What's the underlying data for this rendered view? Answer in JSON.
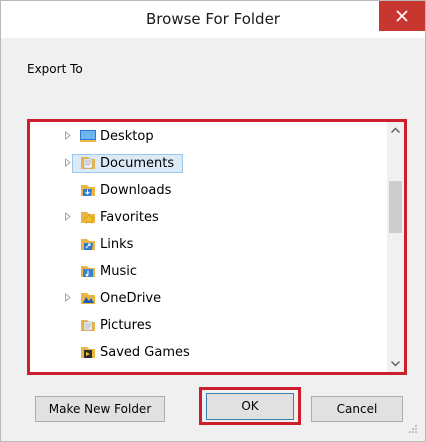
{
  "dialog": {
    "title": "Browse For Folder",
    "description": "Export To"
  },
  "tree": {
    "items": [
      {
        "label": "Desktop",
        "expandable": true,
        "icon": "desktop-folder-icon",
        "selected": false
      },
      {
        "label": "Documents",
        "expandable": true,
        "icon": "documents-folder-icon",
        "selected": true
      },
      {
        "label": "Downloads",
        "expandable": false,
        "icon": "downloads-folder-icon",
        "selected": false
      },
      {
        "label": "Favorites",
        "expandable": true,
        "icon": "favorites-folder-icon",
        "selected": false
      },
      {
        "label": "Links",
        "expandable": false,
        "icon": "links-folder-icon",
        "selected": false
      },
      {
        "label": "Music",
        "expandable": false,
        "icon": "music-folder-icon",
        "selected": false
      },
      {
        "label": "OneDrive",
        "expandable": true,
        "icon": "onedrive-folder-icon",
        "selected": false
      },
      {
        "label": "Pictures",
        "expandable": false,
        "icon": "pictures-folder-icon",
        "selected": false
      },
      {
        "label": "Saved Games",
        "expandable": false,
        "icon": "saved-games-folder-icon",
        "selected": false
      }
    ]
  },
  "buttons": {
    "make_new_folder": "Make New Folder",
    "ok": "OK",
    "cancel": "Cancel"
  },
  "colors": {
    "highlight": "#cc1f2b",
    "close": "#c7372f",
    "selection": "#dceaf8"
  }
}
